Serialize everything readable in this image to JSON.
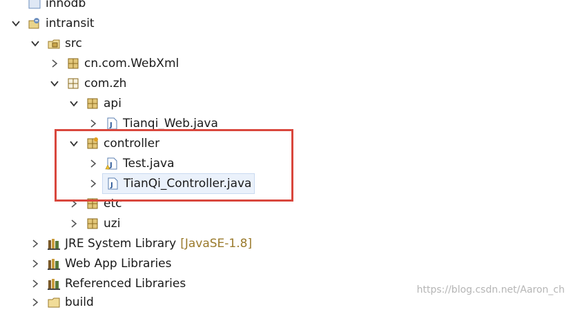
{
  "tree": {
    "items": [
      {
        "label": "innodb"
      },
      {
        "label": "intransit"
      },
      {
        "label": "src"
      },
      {
        "label": "cn.com.WebXml"
      },
      {
        "label": "com.zh"
      },
      {
        "label": "api"
      },
      {
        "label": "Tianqi_Web.java"
      },
      {
        "label": "controller"
      },
      {
        "label": "Test.java"
      },
      {
        "label": "TianQi_Controller.java"
      },
      {
        "label": "etc"
      },
      {
        "label": "uzi"
      },
      {
        "label": "JRE System Library",
        "decoration": "[JavaSE-1.8]"
      },
      {
        "label": "Web App Libraries"
      },
      {
        "label": "Referenced Libraries"
      },
      {
        "label": "build"
      }
    ]
  },
  "watermark": "https://blog.csdn.net/Aaron_ch",
  "colors": {
    "highlight": "#d9473d",
    "decoration": "#9a7a2c",
    "selection": "#eaf1fb"
  },
  "icons": [
    "project-icon",
    "source-folder-icon",
    "package-icon",
    "java-file-icon",
    "library-icon",
    "folder-icon"
  ]
}
